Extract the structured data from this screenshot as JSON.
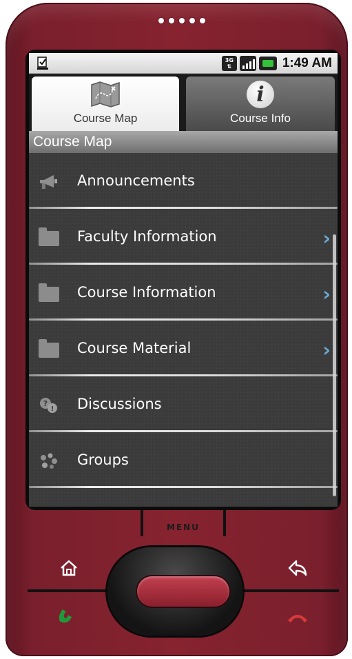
{
  "status_bar": {
    "time": "1:49 AM",
    "network_label": "3G",
    "icons": [
      "download-notification-icon",
      "3g-network-icon",
      "signal-strength-icon",
      "battery-icon"
    ]
  },
  "tabs": [
    {
      "label": "Course Map",
      "icon": "course-map-icon",
      "active": true
    },
    {
      "label": "Course Info",
      "icon": "info-icon",
      "active": false
    }
  ],
  "header": {
    "title": "Course Map"
  },
  "list": {
    "items": [
      {
        "label": "Announcements",
        "icon": "megaphone-icon",
        "has_chevron": false
      },
      {
        "label": "Faculty Information",
        "icon": "folder-icon",
        "has_chevron": true
      },
      {
        "label": "Course Information",
        "icon": "folder-icon",
        "has_chevron": true
      },
      {
        "label": "Course Material",
        "icon": "folder-icon",
        "has_chevron": true
      },
      {
        "label": "Discussions",
        "icon": "discussion-icon",
        "has_chevron": false
      },
      {
        "label": "Groups",
        "icon": "groups-icon",
        "has_chevron": false
      }
    ]
  },
  "hardware": {
    "menu_label": "MENU",
    "buttons": [
      "home-icon",
      "back-icon",
      "call-icon",
      "end-call-icon"
    ]
  },
  "colors": {
    "phone_body": "#86232f",
    "chevron": "#6aa9d8",
    "call_green": "#1f9a3a",
    "end_call_red": "#d83a3a"
  }
}
